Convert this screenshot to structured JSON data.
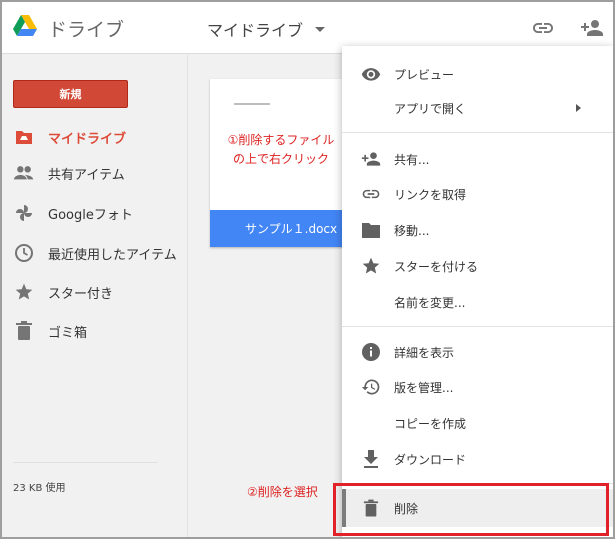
{
  "header": {
    "app_title": "ドライブ",
    "drive_title": "マイドライブ",
    "icons": [
      "drive-logo",
      "chevron-down-icon",
      "link-icon",
      "person-add-icon"
    ]
  },
  "sidebar": {
    "new_label": "新規",
    "items": [
      {
        "label": "マイドライブ",
        "icon": "my-drive-icon",
        "active": true
      },
      {
        "label": "共有アイテム",
        "icon": "people-icon"
      },
      {
        "label": "Googleフォト",
        "icon": "pinwheel-icon"
      },
      {
        "label": "最近使用したアイテム",
        "icon": "clock-icon"
      },
      {
        "label": "スター付き",
        "icon": "star-icon"
      },
      {
        "label": "ゴミ箱",
        "icon": "trash-icon"
      }
    ],
    "storage": "23 KB 使用"
  },
  "file": {
    "name": "サンプル１.docx"
  },
  "annotations": {
    "step1_line1": "①削除するファイル",
    "step1_line2": "の上で右クリック",
    "step2": "②削除を選択"
  },
  "context_menu": {
    "items": [
      {
        "label": "プレビュー",
        "icon": "eye-icon"
      },
      {
        "label": "アプリで開く",
        "icon": "",
        "submenu": true
      },
      {
        "label": "共有...",
        "icon": "person-add-icon"
      },
      {
        "label": "リンクを取得",
        "icon": "link-icon"
      },
      {
        "label": "移動...",
        "icon": "folder-icon"
      },
      {
        "label": "スターを付ける",
        "icon": "star-icon"
      },
      {
        "label": "名前を変更...",
        "icon": ""
      },
      {
        "label": "詳細を表示",
        "icon": "info-icon"
      },
      {
        "label": "版を管理...",
        "icon": "history-icon"
      },
      {
        "label": "コピーを作成",
        "icon": ""
      },
      {
        "label": "ダウンロード",
        "icon": "download-icon"
      },
      {
        "label": "削除",
        "icon": "trash-icon",
        "selected": true
      }
    ]
  },
  "colors": {
    "accent_red": "#dd4b39",
    "new_button": "#d14836",
    "file_bar": "#4285f4",
    "annotation_red": "#dd2222",
    "highlight_red": "#e0212a"
  }
}
